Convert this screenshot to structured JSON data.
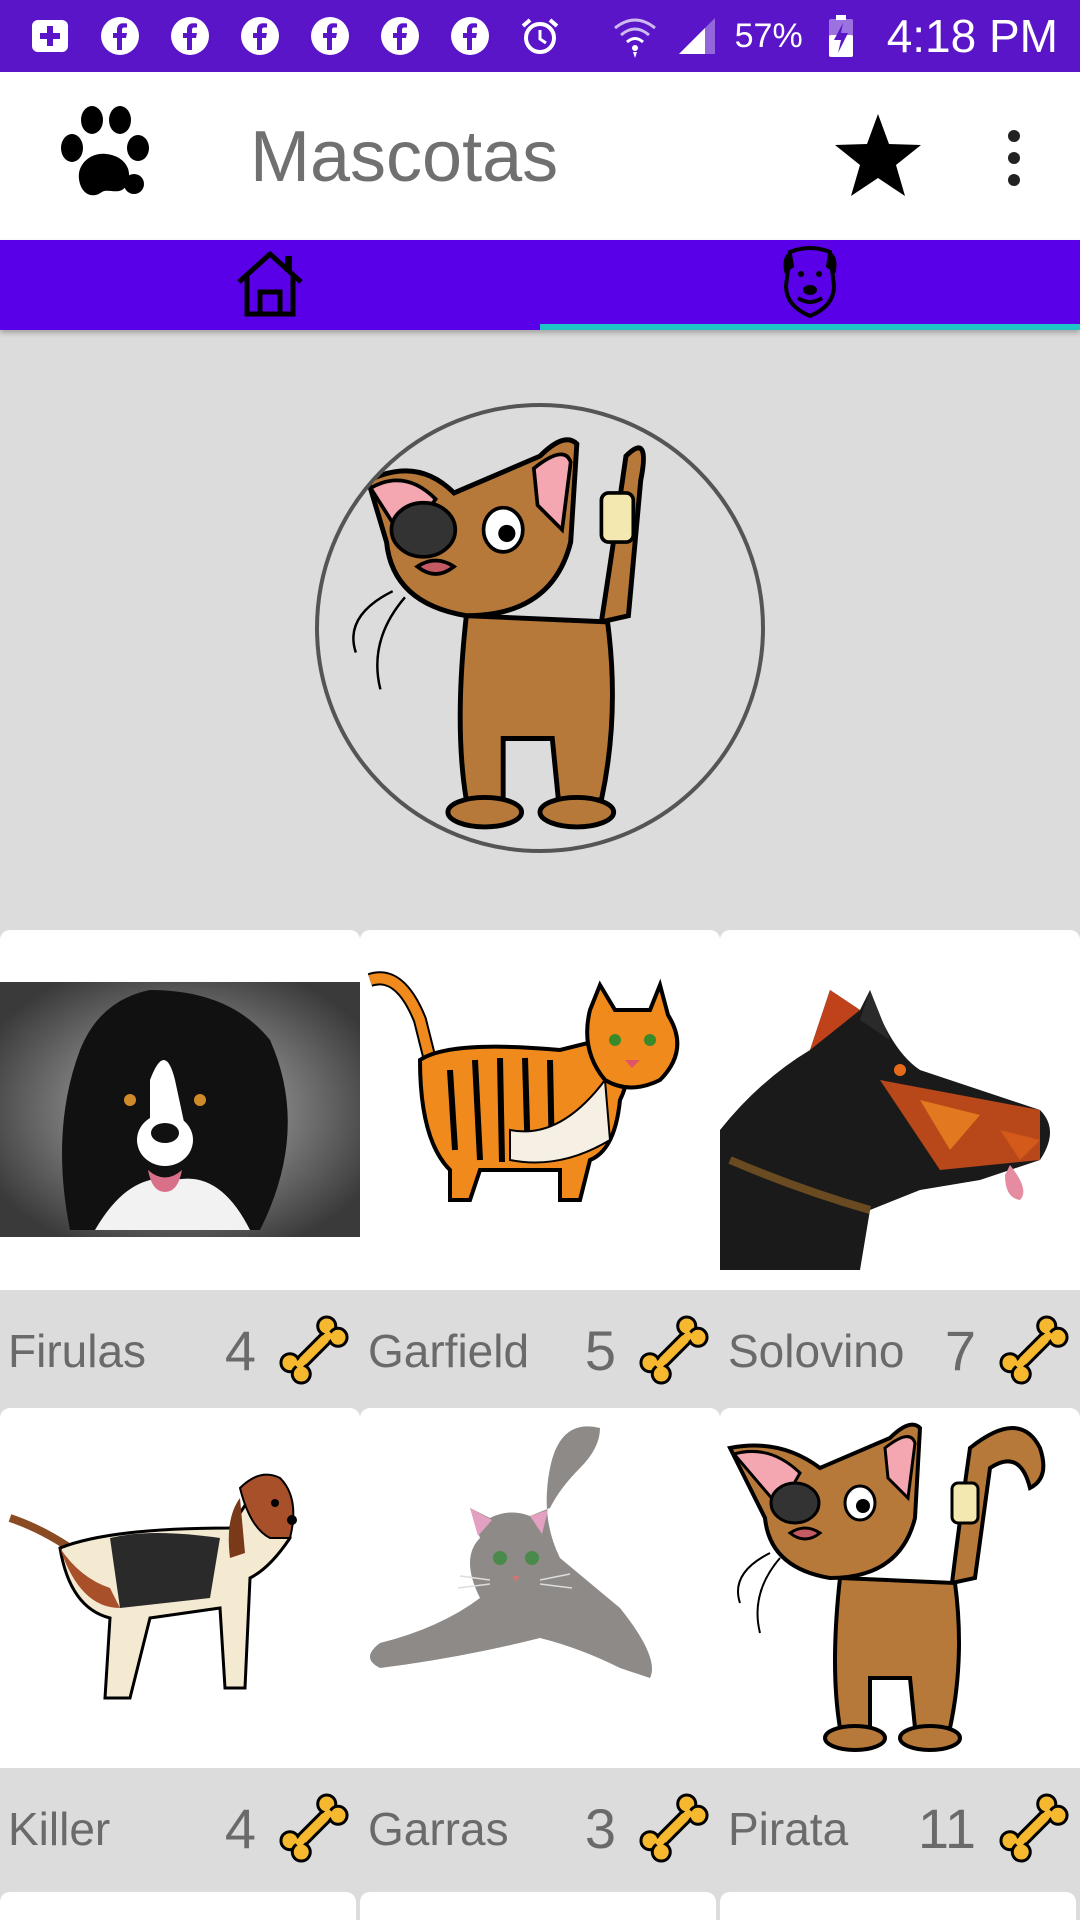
{
  "status_bar": {
    "battery": "57%",
    "time": "4:18 PM",
    "icons": [
      "add-box-icon",
      "facebook-icon",
      "facebook-icon",
      "facebook-icon",
      "facebook-icon",
      "facebook-icon",
      "facebook-icon",
      "alarm-icon",
      "wifi-icon",
      "signal-icon",
      "battery-charging-icon"
    ]
  },
  "app_bar": {
    "title": "Mascotas",
    "logo_icon": "paw-icon",
    "favorite_icon": "star-icon",
    "menu_icon": "more-vert-icon"
  },
  "tabs": [
    {
      "icon": "home-icon",
      "selected": false
    },
    {
      "icon": "dog-face-icon",
      "selected": true
    }
  ],
  "colors": {
    "status_bar": "#5a15c9",
    "tab_bar": "#5a00e8",
    "tab_indicator": "#20c4c6",
    "background": "#dcdcdc",
    "bone": "#f5b82e"
  },
  "featured_pet": {
    "image": "pirate-cat-illustration"
  },
  "pets": [
    {
      "name": "Firulas",
      "likes": "4",
      "image": "border-collie-illustration"
    },
    {
      "name": "Garfield",
      "likes": "5",
      "image": "tabby-cat-illustration"
    },
    {
      "name": "Solovino",
      "likes": "7",
      "image": "doberman-low-poly"
    },
    {
      "name": "Killer",
      "likes": "4",
      "image": "beagle-illustration"
    },
    {
      "name": "Garras",
      "likes": "3",
      "image": "gray-cat-illustration"
    },
    {
      "name": "Pirata",
      "likes": "11",
      "image": "pirate-cat-illustration"
    }
  ]
}
